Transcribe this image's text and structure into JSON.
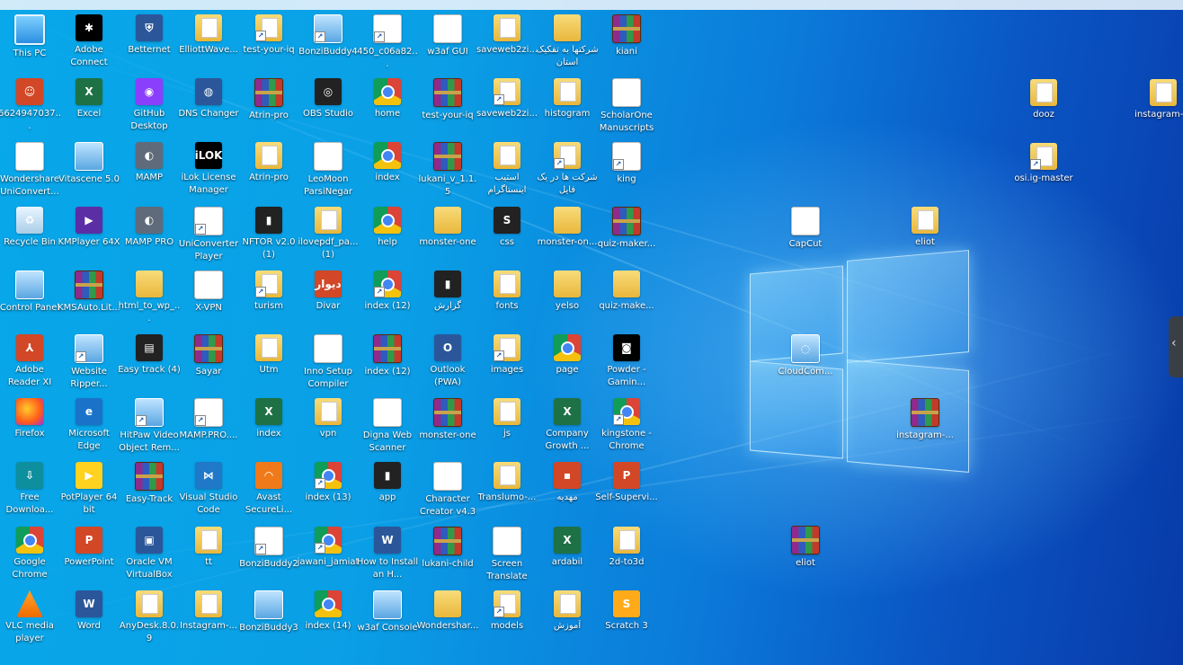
{
  "desktop": {
    "icons": [
      {
        "label": "This PC",
        "kind": "pc",
        "glyph": ""
      },
      {
        "label": "Adobe Connect",
        "kind": "black",
        "glyph": "✱"
      },
      {
        "label": "Betternet",
        "kind": "blue",
        "glyph": "⛨"
      },
      {
        "label": "ElliottWave...",
        "kind": "folderdoc",
        "glyph": ""
      },
      {
        "label": "test-your-iq",
        "kind": "folderdoc",
        "glyph": ""
      },
      {
        "label": "BonziBuddy4",
        "kind": "panel",
        "glyph": ""
      },
      {
        "label": "450_c06a82...",
        "kind": "file",
        "glyph": "≡"
      },
      {
        "label": "w3af GUI",
        "kind": "white",
        "glyph": "◐"
      },
      {
        "label": "saveweb2zi...",
        "kind": "folderdoc",
        "glyph": ""
      },
      {
        "label": "شرکتها به تفکیک استان",
        "kind": "folder",
        "glyph": ""
      },
      {
        "label": "kiani",
        "kind": "winrar",
        "glyph": ""
      },
      {
        "label": "6624947037...",
        "kind": "red",
        "glyph": "☺"
      },
      {
        "label": "Excel",
        "kind": "green",
        "glyph": "X"
      },
      {
        "label": "GitHub Desktop",
        "kind": "gh",
        "glyph": "◉"
      },
      {
        "label": "DNS Changer",
        "kind": "blue",
        "glyph": "◍"
      },
      {
        "label": "Atrin-pro",
        "kind": "winrar",
        "glyph": ""
      },
      {
        "label": "OBS Studio",
        "kind": "dark",
        "glyph": "◎"
      },
      {
        "label": "home",
        "kind": "chrome",
        "glyph": ""
      },
      {
        "label": "test-your-iq",
        "kind": "winrar",
        "glyph": ""
      },
      {
        "label": "saveweb2zi...",
        "kind": "folderdoc",
        "glyph": ""
      },
      {
        "label": "histogram",
        "kind": "folderdoc",
        "glyph": ""
      },
      {
        "label": "ScholarOne Manuscripts",
        "kind": "pdf",
        "glyph": "PDF"
      },
      {
        "label": "Wondershare UniConvert...",
        "kind": "file",
        "glyph": ""
      },
      {
        "label": "Vitascene 5.0",
        "kind": "panel",
        "glyph": ""
      },
      {
        "label": "MAMP",
        "kind": "grey",
        "glyph": "◐"
      },
      {
        "label": "iLok License Manager",
        "kind": "black",
        "glyph": "iLOK"
      },
      {
        "label": "Atrin-pro",
        "kind": "folderdoc",
        "glyph": ""
      },
      {
        "label": "LeoMoon ParsiNegar",
        "kind": "white",
        "glyph": "پ"
      },
      {
        "label": "index",
        "kind": "chrome",
        "glyph": ""
      },
      {
        "label": "lukani_v_1.1.5",
        "kind": "winrar",
        "glyph": ""
      },
      {
        "label": "استیب اینستاگرام",
        "kind": "folderdoc",
        "glyph": ""
      },
      {
        "label": "شرکت ها در یک فایل",
        "kind": "folderdoc",
        "glyph": ""
      },
      {
        "label": "king",
        "kind": "file",
        "glyph": "≡"
      },
      {
        "label": "Recycle Bin",
        "kind": "bin",
        "glyph": "♻"
      },
      {
        "label": "KMPlayer 64X",
        "kind": "purple",
        "glyph": "▶"
      },
      {
        "label": "MAMP PRO",
        "kind": "grey",
        "glyph": "◐"
      },
      {
        "label": "UniConverter Player",
        "kind": "file",
        "glyph": ""
      },
      {
        "label": "NFTOR v2.0 (1)",
        "kind": "dark",
        "glyph": "▮"
      },
      {
        "label": "ilovepdf_pa... (1)",
        "kind": "folderdoc",
        "glyph": ""
      },
      {
        "label": "help",
        "kind": "chrome",
        "glyph": ""
      },
      {
        "label": "monster-one",
        "kind": "folder",
        "glyph": ""
      },
      {
        "label": "css",
        "kind": "dark",
        "glyph": "S"
      },
      {
        "label": "monster-on...",
        "kind": "folder",
        "glyph": ""
      },
      {
        "label": "quiz-maker...",
        "kind": "winrar",
        "glyph": ""
      },
      {
        "label": "Control Panel",
        "kind": "panel",
        "glyph": ""
      },
      {
        "label": "KMSAuto.Lit...",
        "kind": "winrar",
        "glyph": ""
      },
      {
        "label": "html_to_wp_...",
        "kind": "folder",
        "glyph": ""
      },
      {
        "label": "X-VPN",
        "kind": "white",
        "glyph": "✕"
      },
      {
        "label": "turism",
        "kind": "folderdoc",
        "glyph": ""
      },
      {
        "label": "Divar",
        "kind": "red",
        "glyph": "دیوار"
      },
      {
        "label": "index (12)",
        "kind": "chrome",
        "glyph": ""
      },
      {
        "label": "گزارش",
        "kind": "dark",
        "glyph": "▮"
      },
      {
        "label": "fonts",
        "kind": "folderdoc",
        "glyph": ""
      },
      {
        "label": "yelso",
        "kind": "folder",
        "glyph": ""
      },
      {
        "label": "quiz-make...",
        "kind": "folder",
        "glyph": ""
      },
      {
        "label": "Adobe Reader XI",
        "kind": "red",
        "glyph": "⅄"
      },
      {
        "label": "Website Ripper...",
        "kind": "panel",
        "glyph": ""
      },
      {
        "label": "Easy track (4)",
        "kind": "dark",
        "glyph": "▤"
      },
      {
        "label": "Sayar",
        "kind": "winrar",
        "glyph": ""
      },
      {
        "label": "Utm",
        "kind": "folderdoc",
        "glyph": ""
      },
      {
        "label": "Inno Setup Compiler",
        "kind": "file",
        "glyph": ""
      },
      {
        "label": "index (12)",
        "kind": "winrar",
        "glyph": ""
      },
      {
        "label": "Outlook (PWA)",
        "kind": "blue",
        "glyph": "O"
      },
      {
        "label": "images",
        "kind": "folderdoc",
        "glyph": ""
      },
      {
        "label": "page",
        "kind": "chrome",
        "glyph": ""
      },
      {
        "label": "Powder - Gamin...",
        "kind": "black",
        "glyph": "◙"
      },
      {
        "label": "Firefox",
        "kind": "ff",
        "glyph": ""
      },
      {
        "label": "Microsoft Edge",
        "kind": "edge",
        "glyph": "e"
      },
      {
        "label": "HitPaw Video Object Rem...",
        "kind": "panel",
        "glyph": ""
      },
      {
        "label": "MAMP.PRO....",
        "kind": "file",
        "glyph": "◐"
      },
      {
        "label": "index",
        "kind": "green",
        "glyph": "X"
      },
      {
        "label": "vpn",
        "kind": "folderdoc",
        "glyph": ""
      },
      {
        "label": "Digna Web Scanner",
        "kind": "white",
        "glyph": "▦"
      },
      {
        "label": "monster-one",
        "kind": "winrar",
        "glyph": ""
      },
      {
        "label": "js",
        "kind": "folderdoc",
        "glyph": ""
      },
      {
        "label": "Company Growth ...",
        "kind": "green",
        "glyph": "X"
      },
      {
        "label": "kingstone - Chrome",
        "kind": "chrome",
        "glyph": ""
      },
      {
        "label": "Free Downloa...",
        "kind": "teal",
        "glyph": "⇩"
      },
      {
        "label": "PotPlayer 64 bit",
        "kind": "yellow",
        "glyph": "▶"
      },
      {
        "label": "Easy-Track",
        "kind": "winrar",
        "glyph": ""
      },
      {
        "label": "Visual Studio Code",
        "kind": "vs",
        "glyph": "⋈"
      },
      {
        "label": "Avast SecureLi...",
        "kind": "orange",
        "glyph": "◠"
      },
      {
        "label": "index (13)",
        "kind": "chrome",
        "glyph": ""
      },
      {
        "label": "app",
        "kind": "dark",
        "glyph": "▮"
      },
      {
        "label": "Character Creator v4.3",
        "kind": "file",
        "glyph": ""
      },
      {
        "label": "Translumo-...",
        "kind": "folderdoc",
        "glyph": ""
      },
      {
        "label": "مهدیه",
        "kind": "red",
        "glyph": "▪"
      },
      {
        "label": "Self-Supervi...",
        "kind": "red",
        "glyph": "P"
      },
      {
        "label": "Google Chrome",
        "kind": "chrome",
        "glyph": ""
      },
      {
        "label": "PowerPoint",
        "kind": "red",
        "glyph": "P"
      },
      {
        "label": "Oracle VM VirtualBox",
        "kind": "blue",
        "glyph": "▣"
      },
      {
        "label": "tt",
        "kind": "folderdoc",
        "glyph": ""
      },
      {
        "label": "BonziBuddy2",
        "kind": "file",
        "glyph": ""
      },
      {
        "label": "jawani_jamiat",
        "kind": "chrome",
        "glyph": ""
      },
      {
        "label": "How to Install an H...",
        "kind": "blue",
        "glyph": "W"
      },
      {
        "label": "lukani-child",
        "kind": "winrar",
        "glyph": ""
      },
      {
        "label": "Screen Translate",
        "kind": "white",
        "glyph": "文A"
      },
      {
        "label": "ardabil",
        "kind": "green",
        "glyph": "X"
      },
      {
        "label": "2d-to3d",
        "kind": "folderdoc",
        "glyph": ""
      },
      {
        "label": "VLC media player",
        "kind": "cone",
        "glyph": ""
      },
      {
        "label": "Word",
        "kind": "blue",
        "glyph": "W"
      },
      {
        "label": "AnyDesk.8.0.9",
        "kind": "folderdoc",
        "glyph": ""
      },
      {
        "label": "Instagram-...",
        "kind": "folderdoc",
        "glyph": ""
      },
      {
        "label": "BonziBuddy3",
        "kind": "panel",
        "glyph": ""
      },
      {
        "label": "index (14)",
        "kind": "chrome",
        "glyph": ""
      },
      {
        "label": "w3af Console",
        "kind": "panel",
        "glyph": ""
      },
      {
        "label": "Wondershar...",
        "kind": "folder",
        "glyph": ""
      },
      {
        "label": "models",
        "kind": "folderdoc",
        "glyph": ""
      },
      {
        "label": "آموزش",
        "kind": "folderdoc",
        "glyph": ""
      },
      {
        "label": "Scratch 3",
        "kind": "scratch",
        "glyph": "S"
      }
    ],
    "loose_icons": [
      {
        "label": "dooz",
        "kind": "folderdoc",
        "glyph": ""
      },
      {
        "label": "instagram-...",
        "kind": "folderdoc",
        "glyph": ""
      },
      {
        "label": "osi.ig-master",
        "kind": "folderdoc",
        "glyph": ""
      },
      {
        "label": "CapCut",
        "kind": "white",
        "glyph": "✂"
      },
      {
        "label": "eliot",
        "kind": "folderdoc",
        "glyph": ""
      },
      {
        "label": "CloudCom...",
        "kind": "panel",
        "glyph": "◌"
      },
      {
        "label": "instagram-...",
        "kind": "winrar",
        "glyph": ""
      },
      {
        "label": "eliot",
        "kind": "winrar",
        "glyph": ""
      }
    ]
  }
}
